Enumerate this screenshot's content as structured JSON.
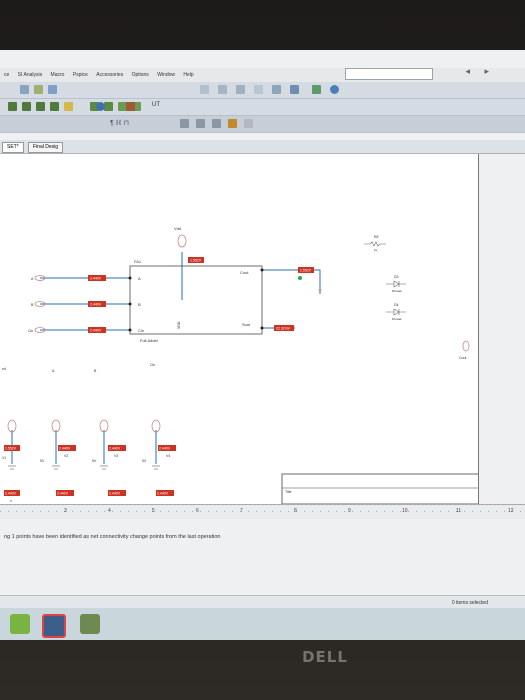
{
  "menu": {
    "items": [
      "ce",
      "SI Analysis",
      "Macro",
      "Pspice",
      "Accessories",
      "Options",
      "Window",
      "Help"
    ]
  },
  "toolbar": {
    "tb1_text": "",
    "tb2_text": "UT",
    "tb3_text": "¶ ℍ ⊓"
  },
  "sheet_tabs": {
    "left": "SET*",
    "active": "Final Desig"
  },
  "schematic": {
    "vdd_label": "Vdd",
    "vdd_marker": "1.552V",
    "block_label": "FA1",
    "block_name": "Full Adder",
    "pins": {
      "a": "A",
      "b": "B",
      "cin": "Cin",
      "cout": "Cout",
      "sum": "Sum",
      "vdd_pin": "VDD"
    },
    "input_nodes": {
      "a": "A",
      "b": "B",
      "cin": "Cin"
    },
    "input_markers": [
      "2.440V",
      "2.440V",
      "2.440V"
    ],
    "cout_marker": "1.552V",
    "sum_marker": "22.32mV",
    "cout_port": "Cout",
    "r5": {
      "name": "R5",
      "value": "1k"
    },
    "d3": {
      "name": "D3",
      "model": "Dbreak"
    },
    "d4": {
      "name": "D4",
      "model": "Dbreak"
    },
    "sources": [
      {
        "top": "",
        "name": "V1",
        "volt": "",
        "top_marker": "1.552V",
        "bottom_marker": "2.440V"
      },
      {
        "top": "A",
        "name": "V2",
        "volt": "5V",
        "top_marker": "2.440V",
        "bottom_marker": "2.440V"
      },
      {
        "top": "B",
        "name": "V3",
        "volt": "5V",
        "top_marker": "2.440V",
        "bottom_marker": "2.440V"
      },
      {
        "top": "Cin",
        "name": "V4",
        "volt": "5V",
        "top_marker": "2.440V",
        "bottom_marker": "2.440V"
      }
    ],
    "ground_label": "0",
    "left_node": "ed",
    "title_block_label": "Title"
  },
  "ruler": {
    "marks": [
      "3",
      "4",
      "5",
      "6",
      "7",
      "8",
      "9",
      "10",
      "11",
      "12"
    ]
  },
  "status": {
    "message": "ng 1 points have been identified as net connectivity change points from the last operation",
    "items_selected": "0 items selected"
  },
  "monitor": {
    "brand": "DELL"
  },
  "colors": {
    "wire": "#2c6bb5",
    "marker": "#cc3322",
    "probe_green": "#27a84a",
    "block_border": "#4a4a4a"
  }
}
